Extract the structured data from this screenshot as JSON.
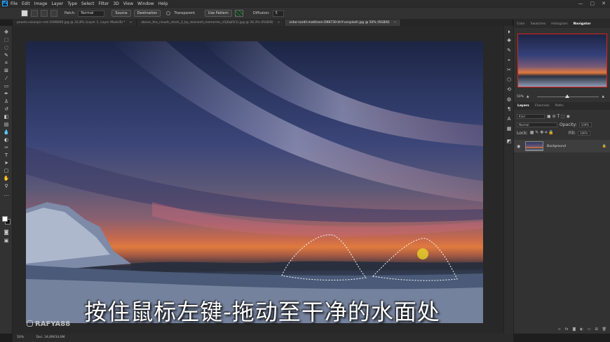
{
  "menu": {
    "logo": "Ps",
    "items": [
      "File",
      "Edit",
      "Image",
      "Layer",
      "Type",
      "Select",
      "Filter",
      "3D",
      "View",
      "Window",
      "Help"
    ]
  },
  "window_controls": {
    "minimize": "—",
    "maximize": "▢",
    "close": "✕"
  },
  "options": {
    "patch_label": "Patch:",
    "patch_value": "Normal",
    "source_label": "Source",
    "destination_label": "Destination",
    "transparent_label": "Transparent",
    "use_pattern_label": "Use Pattern",
    "diffusion_label": "Diffusion:",
    "diffusion_value": "5"
  },
  "tabs": [
    {
      "label": "pexels-visionpic-net-1008000.jpg @ 32,8% (Layer 1, Layer Mask/8) *",
      "active": false
    },
    {
      "label": "above_the_clouds_stock_2_by_stairwell_memories_d1j0qt5(1).jpg @ 30,3% (RGB/8)",
      "active": false
    },
    {
      "label": "vidar-nordli-mathisen-D98730-khY-unsplash.jpg @ 50% (RGB/8)",
      "active": true
    }
  ],
  "subtitle": "按住鼠标左键-拖动至干净的水面处",
  "watermark": "RAFYA88",
  "panels": {
    "top_tabs": [
      "Color",
      "Swatches",
      "Histogram",
      "Navigator"
    ],
    "zoom": "50%",
    "layers_tabs": [
      "Layers",
      "Channels",
      "Paths"
    ],
    "kind_label": "Kind",
    "blend_mode": "Normal",
    "opacity_label": "Opacity:",
    "opacity_value": "100%",
    "lock_label": "Lock:",
    "fill_label": "Fill:",
    "fill_value": "100%",
    "layer_name": "Background"
  },
  "status": {
    "zoom": "50%",
    "doc": "Doc: 34,6M/34,6M"
  },
  "colors": {
    "accent": "#31a8ff",
    "navigator_box": "#e02020",
    "cursor": "#e6d228"
  }
}
